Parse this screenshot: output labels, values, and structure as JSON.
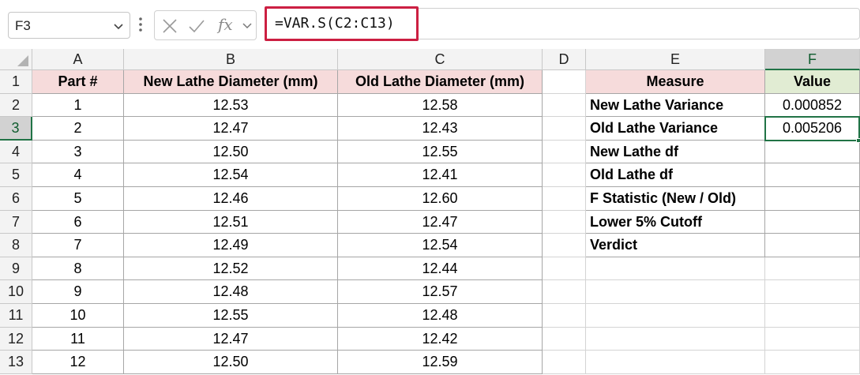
{
  "formula_bar": {
    "name_box": "F3",
    "formula": "=VAR.S(C2:C13)",
    "fx_label": "fx",
    "highlight_color": "#cc1f42"
  },
  "icons": {
    "cancel": "cancel-x-icon",
    "enter": "enter-check-icon",
    "function": "insert-function-icon",
    "expand": "chevron-down-icon"
  },
  "columns": [
    "A",
    "B",
    "C",
    "D",
    "E",
    "F"
  ],
  "rows": [
    "1",
    "2",
    "3",
    "4",
    "5",
    "6",
    "7",
    "8",
    "9",
    "10",
    "11",
    "12",
    "13"
  ],
  "table_left": {
    "headers": [
      "Part #",
      "New Lathe Diameter (mm)",
      "Old Lathe Diameter (mm)"
    ],
    "rows": [
      [
        "1",
        "12.53",
        "12.58"
      ],
      [
        "2",
        "12.47",
        "12.43"
      ],
      [
        "3",
        "12.50",
        "12.55"
      ],
      [
        "4",
        "12.54",
        "12.41"
      ],
      [
        "5",
        "12.46",
        "12.60"
      ],
      [
        "6",
        "12.51",
        "12.47"
      ],
      [
        "7",
        "12.49",
        "12.54"
      ],
      [
        "8",
        "12.52",
        "12.44"
      ],
      [
        "9",
        "12.48",
        "12.57"
      ],
      [
        "10",
        "12.55",
        "12.48"
      ],
      [
        "11",
        "12.47",
        "12.42"
      ],
      [
        "12",
        "12.50",
        "12.59"
      ]
    ]
  },
  "table_right": {
    "headers": [
      "Measure",
      "Value"
    ],
    "rows": [
      [
        "New Lathe Variance",
        "0.000852"
      ],
      [
        "Old Lathe Variance",
        "0.005206"
      ],
      [
        "New Lathe df",
        ""
      ],
      [
        "Old Lathe df",
        ""
      ],
      [
        "F Statistic (New / Old)",
        ""
      ],
      [
        "Lower 5% Cutoff",
        ""
      ],
      [
        "Verdict",
        ""
      ]
    ]
  },
  "colors": {
    "header_pink": "#f6dbdb",
    "header_green": "#e1ecd3",
    "selection_green": "#217346"
  }
}
